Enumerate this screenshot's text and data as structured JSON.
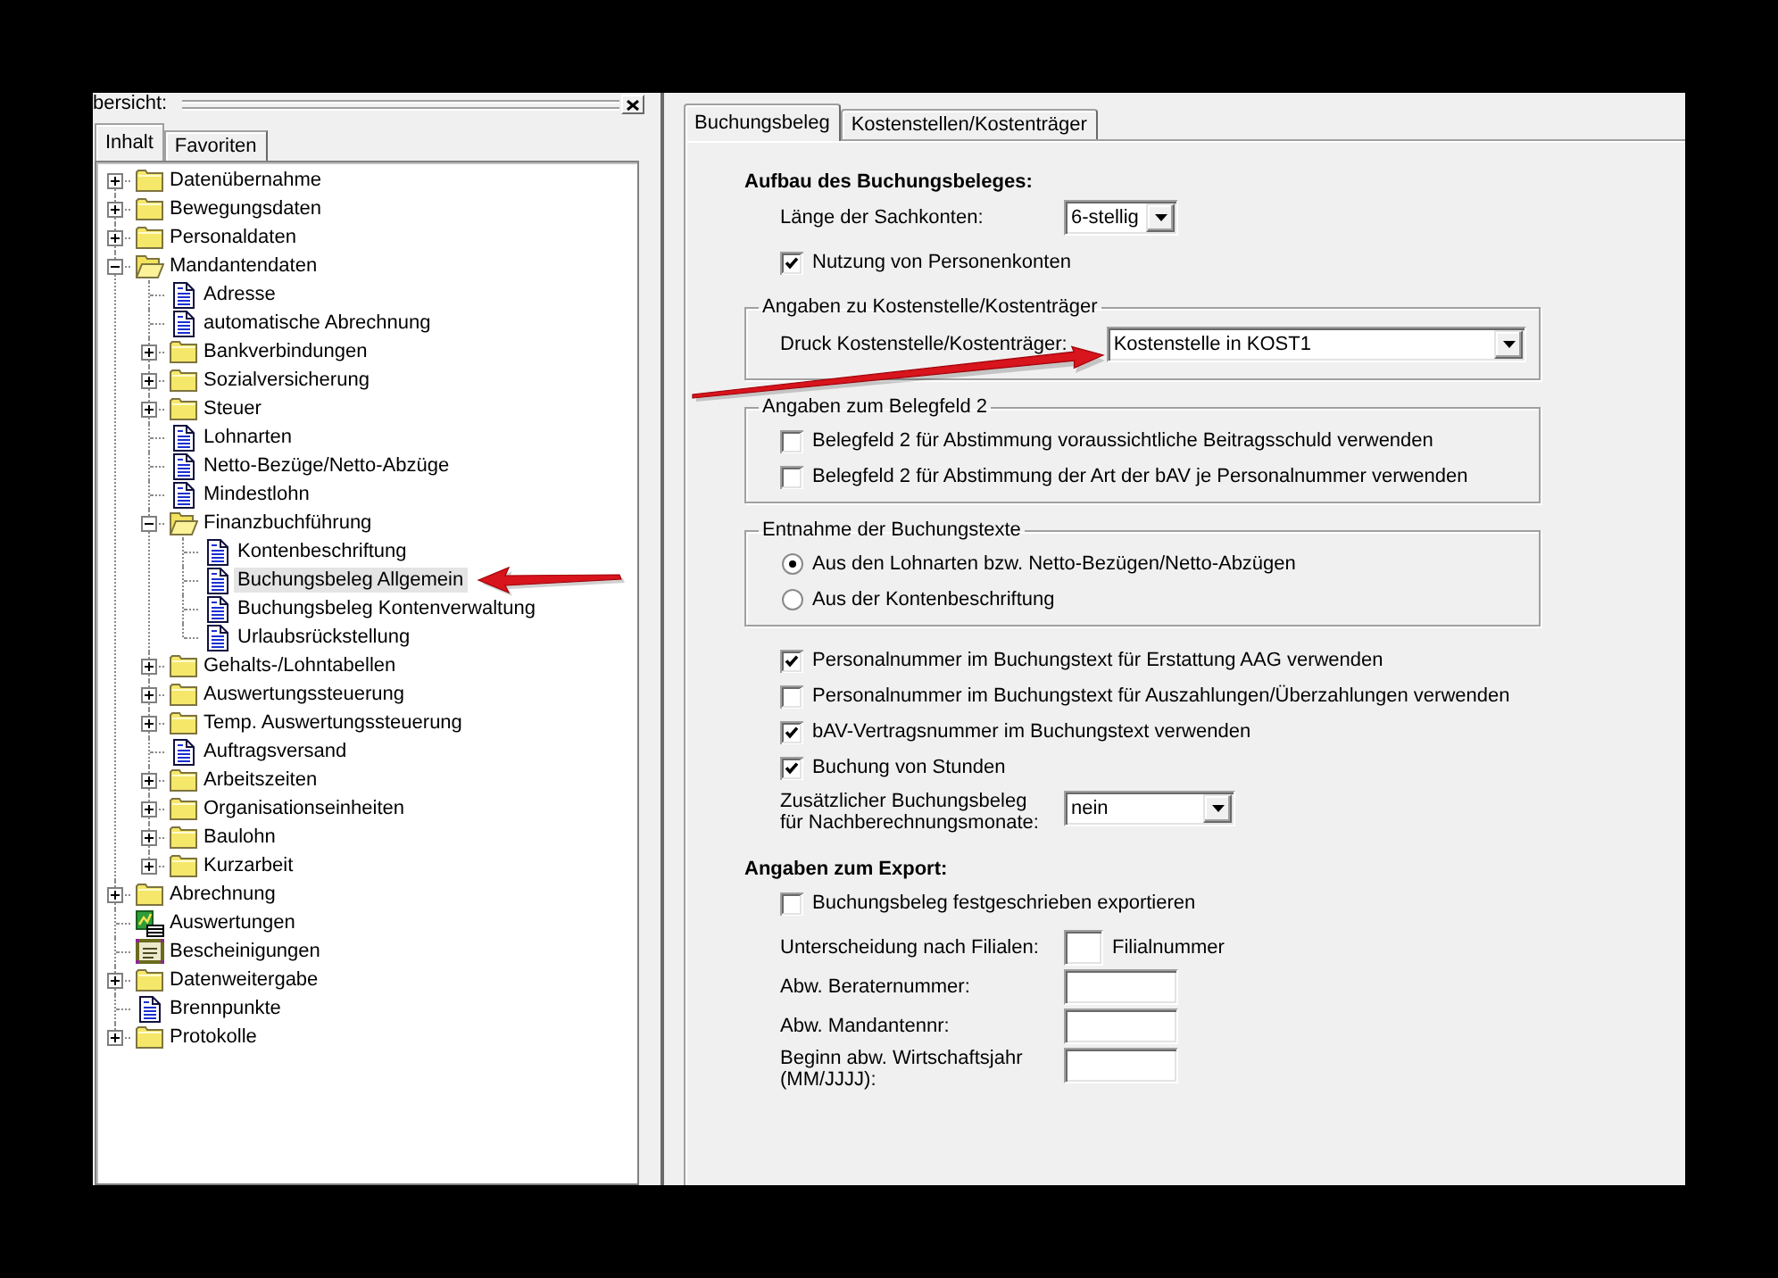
{
  "left_panel": {
    "title": "bersicht:",
    "tabs": [
      {
        "label": "Inhalt",
        "selected": true
      },
      {
        "label": "Favoriten",
        "selected": false
      }
    ],
    "tree": [
      {
        "label": "Datenübernahme",
        "kind": "folder",
        "expanded": false,
        "selected": false
      },
      {
        "label": "Bewegungsdaten",
        "kind": "folder",
        "expanded": false,
        "selected": false
      },
      {
        "label": "Personaldaten",
        "kind": "folder",
        "expanded": false,
        "selected": false
      },
      {
        "label": "Mandantendaten",
        "kind": "folder",
        "expanded": true,
        "selected": false,
        "children": [
          {
            "label": "Adresse",
            "kind": "document",
            "selected": false
          },
          {
            "label": "automatische Abrechnung",
            "kind": "document",
            "selected": false
          },
          {
            "label": "Bankverbindungen",
            "kind": "folder",
            "expanded": false,
            "selected": false
          },
          {
            "label": "Sozialversicherung",
            "kind": "folder",
            "expanded": false,
            "selected": false
          },
          {
            "label": "Steuer",
            "kind": "folder",
            "expanded": false,
            "selected": false
          },
          {
            "label": "Lohnarten",
            "kind": "document",
            "selected": false
          },
          {
            "label": "Netto-Bezüge/Netto-Abzüge",
            "kind": "document",
            "selected": false
          },
          {
            "label": "Mindestlohn",
            "kind": "document",
            "selected": false
          },
          {
            "label": "Finanzbuchführung",
            "kind": "folder",
            "expanded": true,
            "selected": false,
            "children": [
              {
                "label": "Kontenbeschriftung",
                "kind": "document",
                "selected": false
              },
              {
                "label": "Buchungsbeleg Allgemein",
                "kind": "document",
                "selected": true
              },
              {
                "label": "Buchungsbeleg Kontenverwaltung",
                "kind": "document",
                "selected": false
              },
              {
                "label": "Urlaubsrückstellung",
                "kind": "document",
                "selected": false
              }
            ]
          },
          {
            "label": "Gehalts-/Lohntabellen",
            "kind": "folder",
            "expanded": false,
            "selected": false
          },
          {
            "label": "Auswertungssteuerung",
            "kind": "folder",
            "expanded": false,
            "selected": false
          },
          {
            "label": "Temp. Auswertungssteuerung",
            "kind": "folder",
            "expanded": false,
            "selected": false
          },
          {
            "label": "Auftragsversand",
            "kind": "document",
            "selected": false
          },
          {
            "label": "Arbeitszeiten",
            "kind": "folder",
            "expanded": false,
            "selected": false
          },
          {
            "label": "Organisationseinheiten",
            "kind": "folder",
            "expanded": false,
            "selected": false
          },
          {
            "label": "Baulohn",
            "kind": "folder",
            "expanded": false,
            "selected": false
          },
          {
            "label": "Kurzarbeit",
            "kind": "folder",
            "expanded": false,
            "selected": false
          }
        ]
      },
      {
        "label": "Abrechnung",
        "kind": "folder",
        "expanded": false,
        "selected": false
      },
      {
        "label": "Auswertungen",
        "kind": "report",
        "selected": false
      },
      {
        "label": "Bescheinigungen",
        "kind": "certificate",
        "selected": false
      },
      {
        "label": "Datenweitergabe",
        "kind": "folder",
        "expanded": false,
        "selected": false
      },
      {
        "label": "Brennpunkte",
        "kind": "document",
        "selected": false
      },
      {
        "label": "Protokolle",
        "kind": "folder",
        "expanded": false,
        "selected": false
      }
    ]
  },
  "right_panel": {
    "tabs": [
      {
        "label": "Buchungsbeleg",
        "selected": true
      },
      {
        "label": "Kostenstellen/Kostenträger",
        "selected": false
      }
    ],
    "content": [
      {
        "kind": "heading",
        "text": "Aufbau des Buchungsbeleges:"
      },
      {
        "kind": "select",
        "label": "Länge der Sachkonten:",
        "value": "6-stellig"
      },
      {
        "kind": "checkbox",
        "label": "Nutzung von Personenkonten",
        "checked": true
      },
      {
        "kind": "group",
        "legend": "Angaben zu Kostenstelle/Kostenträger",
        "items": [
          {
            "kind": "select",
            "label": "Druck Kostenstelle/Kostenträger:",
            "value": "Kostenstelle in KOST1"
          }
        ]
      },
      {
        "kind": "group",
        "legend": "Angaben zum Belegfeld 2",
        "items": [
          {
            "kind": "checkbox",
            "label": "Belegfeld 2 für Abstimmung voraussichtliche Beitragsschuld verwenden",
            "checked": false
          },
          {
            "kind": "checkbox",
            "label": "Belegfeld 2 für Abstimmung der Art der bAV je Personalnummer verwenden",
            "checked": false
          }
        ]
      },
      {
        "kind": "group",
        "legend": "Entnahme der Buchungstexte",
        "items": [
          {
            "kind": "radio",
            "label": "Aus den Lohnarten bzw. Netto-Bezügen/Netto-Abzügen",
            "selected": true
          },
          {
            "kind": "radio",
            "label": "Aus der Kontenbeschriftung",
            "selected": false
          }
        ]
      },
      {
        "kind": "checkbox",
        "label": "Personalnummer im Buchungstext für Erstattung AAG verwenden",
        "checked": true
      },
      {
        "kind": "checkbox",
        "label": "Personalnummer im Buchungstext für Auszahlungen/Überzahlungen verwenden",
        "checked": false
      },
      {
        "kind": "checkbox",
        "label": "bAV-Vertragsnummer im Buchungstext verwenden",
        "checked": true
      },
      {
        "kind": "checkbox",
        "label": "Buchung von Stunden",
        "checked": true
      },
      {
        "kind": "select",
        "label": "Zusätzlicher Buchungsbeleg für Nachberechnungsmonate:",
        "value": "nein"
      },
      {
        "kind": "heading",
        "text": "Angaben zum Export:"
      },
      {
        "kind": "checkbox",
        "label": "Buchungsbeleg festgeschrieben exportieren",
        "checked": false
      },
      {
        "kind": "input",
        "label": "Unterscheidung nach Filialen:",
        "suffix": "Filialnummer"
      },
      {
        "kind": "input",
        "label": "Abw. Beraternummer:"
      },
      {
        "kind": "input",
        "label": "Abw. Mandantennr:"
      },
      {
        "kind": "input",
        "label": "Beginn abw. Wirtschaftsjahr (MM/JJJJ):"
      }
    ]
  }
}
